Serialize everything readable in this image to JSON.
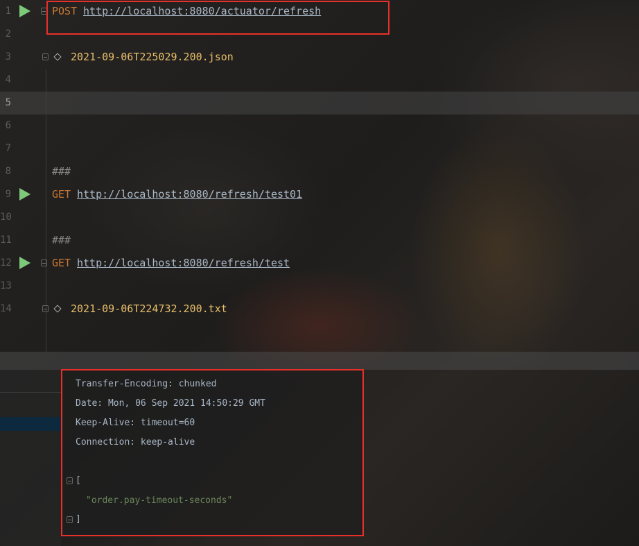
{
  "editor": {
    "lines": [
      {
        "num": "1",
        "method": "POST",
        "url": "http://localhost:8080/actuator/refresh"
      },
      {
        "num": "2"
      },
      {
        "num": "3",
        "file": "2021-09-06T225029.200.json"
      },
      {
        "num": "4"
      },
      {
        "num": "5"
      },
      {
        "num": "6"
      },
      {
        "num": "7"
      },
      {
        "num": "8",
        "comment": "###"
      },
      {
        "num": "9",
        "method": "GET",
        "url": "http://localhost:8080/refresh/test01"
      },
      {
        "num": "10"
      },
      {
        "num": "11",
        "comment": "###"
      },
      {
        "num": "12",
        "method": "GET",
        "url": "http://localhost:8080/refresh/test"
      },
      {
        "num": "13"
      },
      {
        "num": "14",
        "file": "2021-09-06T224732.200.txt"
      }
    ]
  },
  "response": {
    "headers": [
      "Transfer-Encoding: chunked",
      "Date: Mon, 06 Sep 2021 14:50:29 GMT",
      "Keep-Alive: timeout=60",
      "Connection: keep-alive"
    ],
    "body_open": "[",
    "body_items": [
      "\"order.pay-timeout-seconds\""
    ],
    "body_close": "]"
  },
  "colors": {
    "highlight": "#e8302a",
    "run_icon": "#7ec87a",
    "keyword": "#cc7832",
    "filename": "#e8bf6a",
    "string": "#6a8759"
  }
}
